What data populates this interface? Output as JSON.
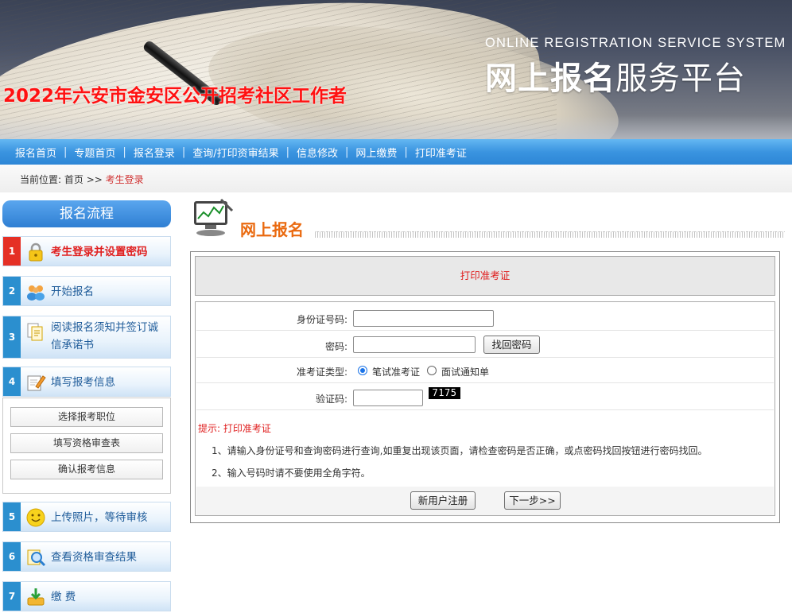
{
  "banner": {
    "en_title": "ONLINE REGISTRATION SERVICE SYSTEM",
    "cn_title_bold": "网上报名",
    "cn_title_light": "服务平台",
    "exam_title": "2022年六安市金安区公开招考社区工作者"
  },
  "nav": {
    "items": [
      "报名首页",
      "专题首页",
      "报名登录",
      "查询/打印资审结果",
      "信息修改",
      "网上缴费",
      "打印准考证"
    ],
    "separator": "|"
  },
  "breadcrumb": {
    "prefix": "当前位置:",
    "home": "首页",
    "sep": ">>",
    "current": "考生登录"
  },
  "sidebar": {
    "title": "报名流程",
    "steps": [
      {
        "num": "1",
        "label": "考生登录并设置密码",
        "icon": "lock-icon"
      },
      {
        "num": "2",
        "label": "开始报名",
        "icon": "users-icon"
      },
      {
        "num": "3",
        "label": "阅读报名须知并签订诚信承诺书",
        "label_line1": "阅读报名须知并签订诚",
        "label_line2": "信承诺书",
        "icon": "documents-icon"
      },
      {
        "num": "4",
        "label": "填写报考信息",
        "icon": "edit-icon"
      },
      {
        "num": "5",
        "label": "上传照片，等待审核",
        "icon": "smiley-icon"
      },
      {
        "num": "6",
        "label": "查看资格审查结果",
        "icon": "magnifier-icon"
      },
      {
        "num": "7",
        "label": "缴 费",
        "icon": "download-icon"
      }
    ],
    "sub_buttons": [
      "选择报考职位",
      "填写资格审查表",
      "确认报考信息"
    ]
  },
  "main": {
    "heading": "网上报名",
    "panel_title": "打印准考证",
    "form": {
      "id_label": "身份证号码:",
      "id_value": "",
      "password_label": "密码:",
      "password_value": "",
      "forgot_button": "找回密码",
      "type_label": "准考证类型:",
      "type_options": [
        "笔试准考证",
        "面试通知单"
      ],
      "type_selected": "笔试准考证",
      "captcha_label": "验证码:",
      "captcha_value": "",
      "captcha_code": "7175"
    },
    "tips": {
      "title": "提示: 打印准考证",
      "lines": [
        "1、请输入身份证号和查询密码进行查询,如重复出现该页面，请检查密码是否正确，或点密码找回按钮进行密码找回。",
        "2、输入号码时请不要使用全角字符。"
      ]
    },
    "buttons": {
      "register": "新用户注册",
      "next": "下一步>>"
    }
  },
  "colors": {
    "nav_blue": "#3a94e0",
    "accent_red": "#e02020",
    "heading_orange": "#ea6a10",
    "step_blue": "#2b8fcf"
  }
}
